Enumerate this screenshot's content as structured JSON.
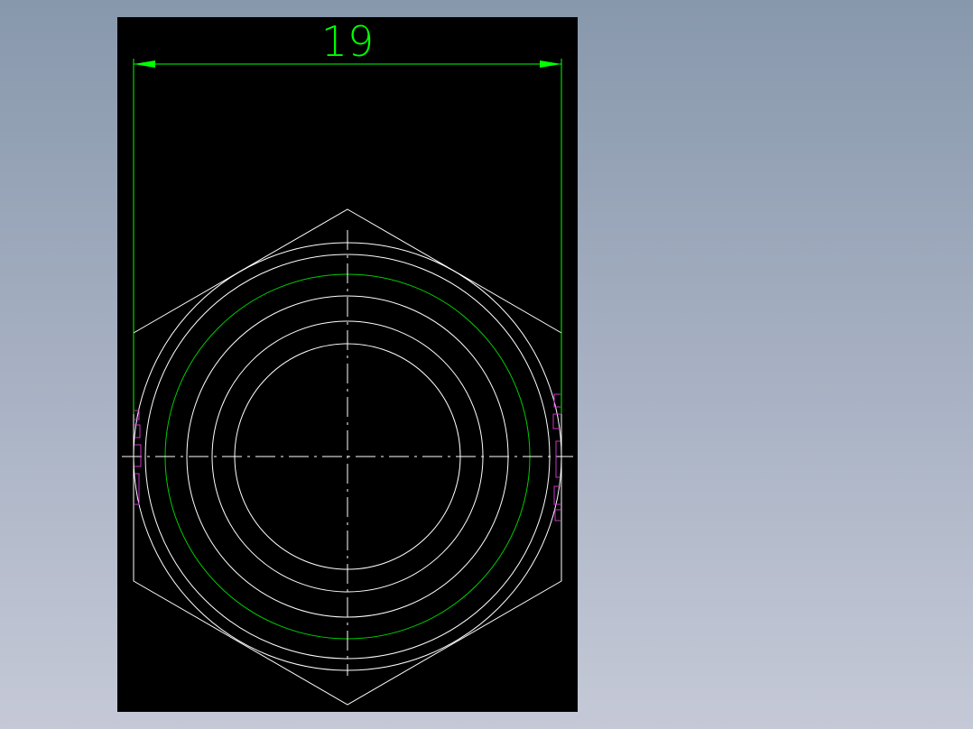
{
  "drawing": {
    "dimension_value": "19",
    "colors": {
      "background": "#000000",
      "geometry": "#ffffff",
      "dimension": "#00ff00",
      "thread_circle": "#00cc00",
      "hidden_marks": "#cc33cc"
    }
  }
}
